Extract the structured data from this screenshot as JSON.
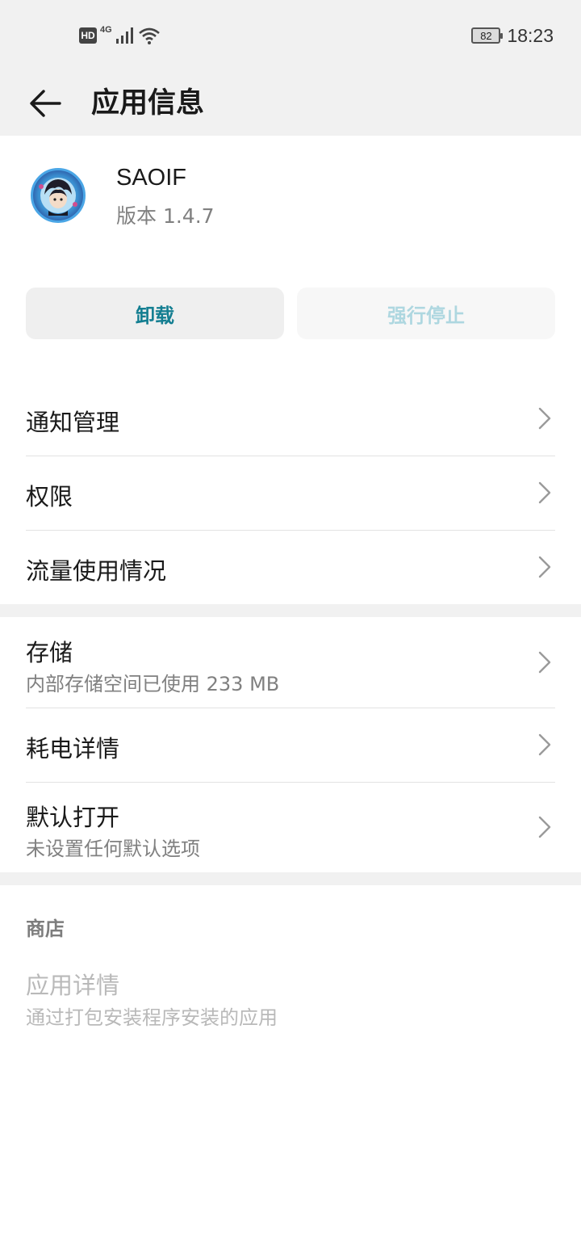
{
  "status_bar": {
    "hd": "HD",
    "network": "4G",
    "battery": "82",
    "time": "18:23"
  },
  "header": {
    "title": "应用信息"
  },
  "app": {
    "name": "SAOIF",
    "version": "版本 1.4.7"
  },
  "actions": {
    "uninstall": "卸载",
    "force_stop": "强行停止"
  },
  "settings": {
    "notifications": "通知管理",
    "permissions": "权限",
    "data_usage": "流量使用情况",
    "storage_title": "存储",
    "storage_sub": "内部存储空间已使用 233 MB",
    "battery_usage": "耗电详情",
    "open_default_title": "默认打开",
    "open_default_sub": "未设置任何默认选项"
  },
  "store": {
    "label": "商店",
    "title": "应用详情",
    "sub": "通过打包安装程序安装的应用"
  },
  "colors": {
    "accent": "#137e91",
    "disabled_accent": "#aed7e0",
    "header_bg": "#f1f1f1"
  }
}
